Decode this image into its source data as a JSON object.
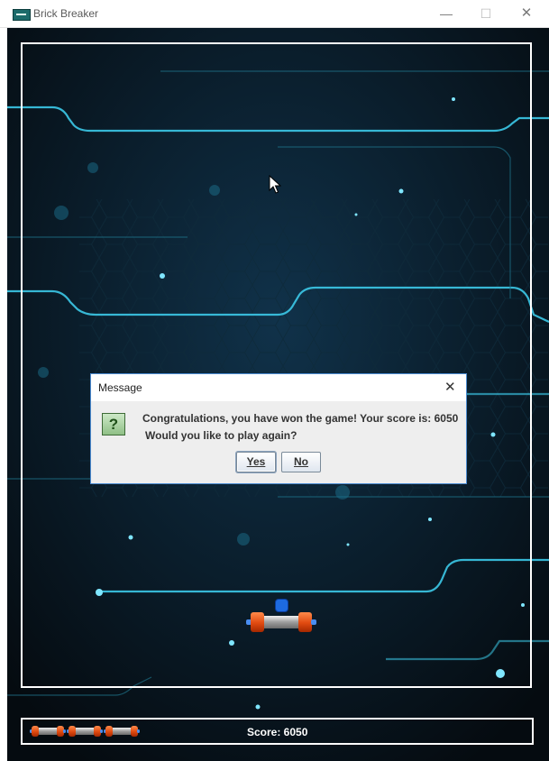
{
  "window": {
    "title": "Brick Breaker",
    "minimize_glyph": "—",
    "maximize_glyph": "☐",
    "close_glyph": "✕"
  },
  "game": {
    "score_text": "Score: 6050",
    "lives_remaining": 3,
    "colors": {
      "background": "#071017",
      "circuit_line": "#3cc9e8",
      "border": "#ffffff",
      "ball": "#1d6ae0",
      "paddle_cap": "#e04a10",
      "paddle_body": "#9d9d9d"
    }
  },
  "dialog": {
    "title": "Message",
    "close_glyph": "✕",
    "icon": "question-icon",
    "icon_glyph": "?",
    "message_line1": "Congratulations, you have won the game! Your score is: 6050",
    "message_line2": "Would you like to play again?",
    "yes_label": "Yes",
    "no_label": "No"
  }
}
